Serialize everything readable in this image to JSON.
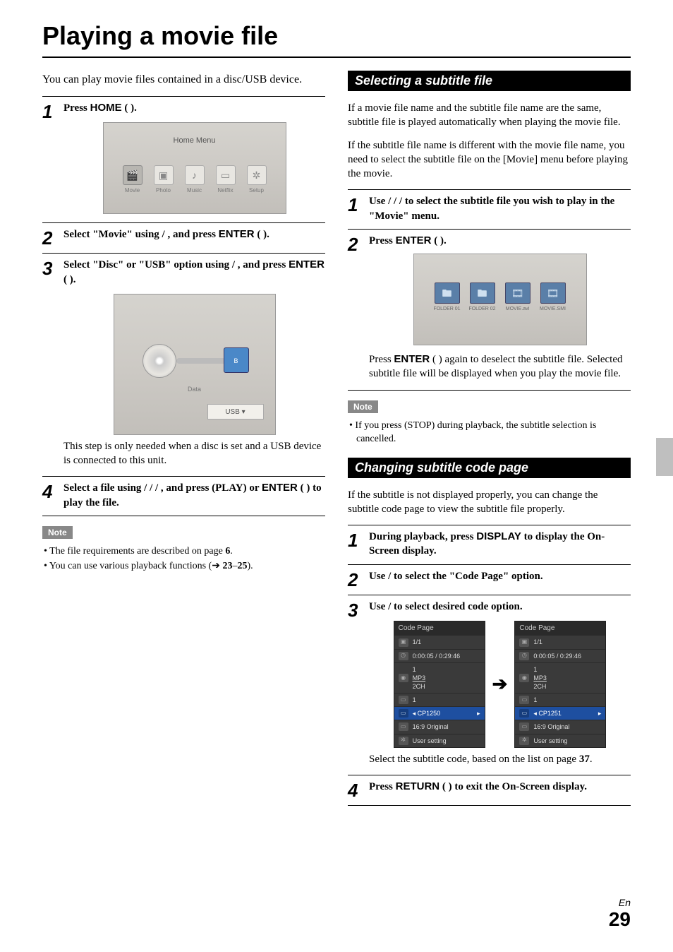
{
  "page": {
    "title": "Playing a movie file",
    "language": "En",
    "number": "29"
  },
  "left": {
    "intro": "You can play movie files contained in a disc/USB device.",
    "steps": {
      "s1": {
        "n": "1",
        "pre": "Press ",
        "btn": "HOME",
        "post": " (    )."
      },
      "s2": {
        "n": "2",
        "pre": "Select \"Movie\" using    /   , and press ",
        "btn": "ENTER",
        "post": " (    )."
      },
      "s3": {
        "n": "3",
        "pre": "Select \"Disc\" or \"USB\" option using    /   , and press ",
        "btn": "ENTER",
        "post": " (    ).",
        "follow": "This step is only needed when a disc is set and a USB device is connected to this unit."
      },
      "s4": {
        "n": "4",
        "pre": "Select a file using    /   /   /   , and press    (PLAY) or ",
        "btn": "ENTER",
        "post": " (    ) to play the file."
      }
    },
    "home_menu": {
      "title": "Home Menu",
      "items": {
        "movie": "Movie",
        "photo": "Photo",
        "music": "Music",
        "netflix": "Netflix",
        "setup": "Setup"
      }
    },
    "disc_scr": {
      "data": "Data",
      "usb": "USB",
      "usb_badge": "B"
    },
    "note": {
      "label": "Note",
      "l1_a": "The file requirements are described on page ",
      "l1_b": "6",
      "l1_c": ".",
      "l2_a": "You can use various playback functions (➔ ",
      "l2_b": "23",
      "l2_c": "–",
      "l2_d": "25",
      "l2_e": ")."
    }
  },
  "right": {
    "subtitle_section": {
      "heading": "Selecting a subtitle file",
      "p1": "If a movie file name and the subtitle file name are the same, subtitle file is played automatically when playing the movie file.",
      "p2": "If the subtitle file name is different with the movie file name, you need to select the subtitle file on the [Movie] menu before playing the movie.",
      "steps": {
        "s1": {
          "n": "1",
          "text": "Use    /   /   /    to select the subtitle file you wish to play in the \"Movie\" menu."
        },
        "s2": {
          "n": "2",
          "pre": "Press ",
          "btn": "ENTER",
          "post": " (    )."
        }
      },
      "tiles": {
        "a": "FOLDER 01",
        "b": "FOLDER 02",
        "c": "MOVIE.avi",
        "d": "MOVIE.SMI"
      },
      "post_a": "Press ",
      "post_btn": "ENTER",
      "post_b": " (    ) again to deselect the subtitle file. Selected subtitle file will be displayed when you play the movie file.",
      "note": {
        "label": "Note",
        "l1": "If you press     (STOP) during playback, the subtitle selection is cancelled."
      }
    },
    "codepage_section": {
      "heading": "Changing subtitle code page",
      "p1": "If the subtitle is not displayed properly, you can change the subtitle code page to view the subtitle file properly.",
      "steps": {
        "s1": {
          "n": "1",
          "pre": "During playback, press ",
          "btn": "DISPLAY",
          "post": " to display the On-Screen display."
        },
        "s2": {
          "n": "2",
          "text": "Use    /    to select the \"Code Page\" option."
        },
        "s3": {
          "n": "3",
          "text": "Use    /    to select desired code option."
        },
        "s4": {
          "n": "4",
          "pre": "Press ",
          "btn": "RETURN",
          "post": " (    ) to exit the On-Screen display."
        }
      },
      "panel": {
        "header": "Code Page",
        "r1": "1/1",
        "r2": "0:00:05 / 0:29:46",
        "r3a": "1",
        "r3b": "MP3",
        "r3c": "2CH",
        "r4": "1",
        "r5_left": "◂ CP1250",
        "r5_left_arr": "▸",
        "r5_right": "◂ CP1251",
        "r5_right_arr": "▸",
        "r6": "16:9 Original",
        "r7": "User setting"
      },
      "follow_a": "Select the subtitle code, based on the list on page ",
      "follow_b": "37",
      "follow_c": "."
    }
  }
}
